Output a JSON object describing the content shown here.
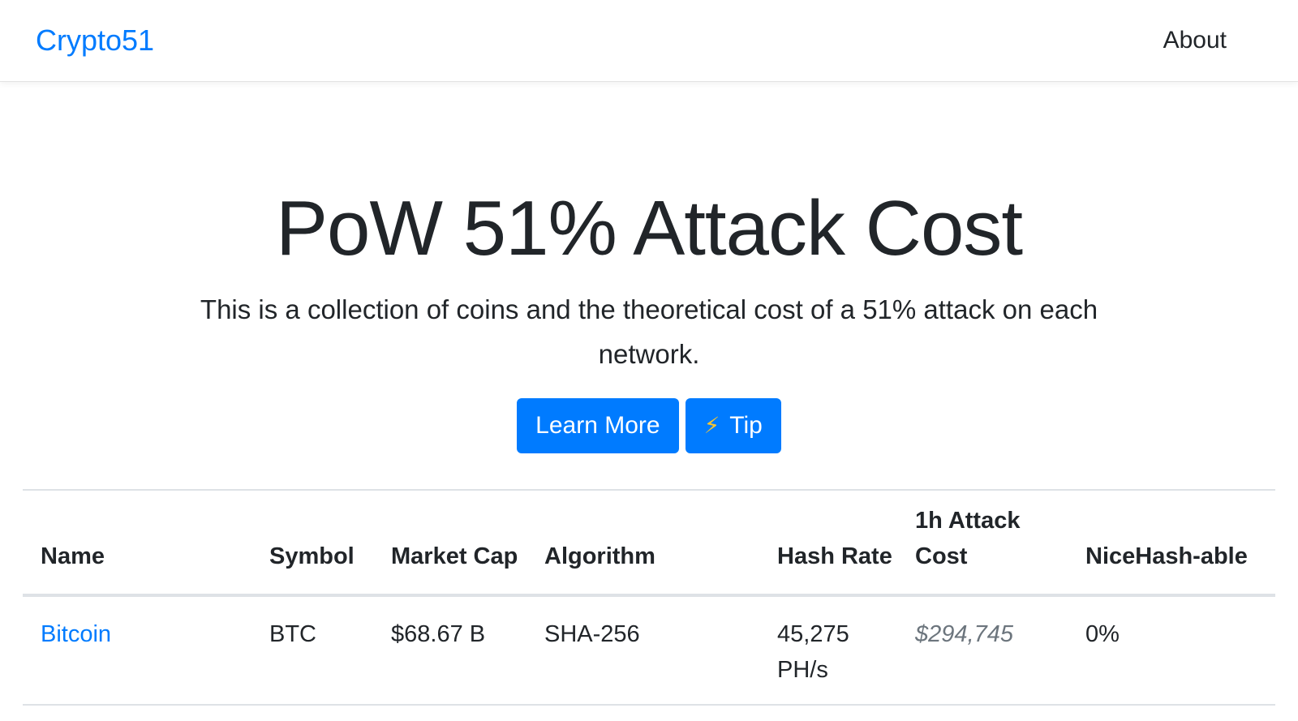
{
  "navbar": {
    "brand": "Crypto51",
    "about_label": "About"
  },
  "hero": {
    "title": "PoW 51% Attack Cost",
    "lead": "This is a collection of coins and the theoretical cost of a 51% attack on each network.",
    "learn_more_label": "Learn More",
    "tip_icon": "lightning-bolt-icon",
    "tip_glyph": "⚡",
    "tip_label": "Tip"
  },
  "table": {
    "headers": [
      "Name",
      "Symbol",
      "Market Cap",
      "Algorithm",
      "Hash Rate",
      "1h Attack Cost",
      "NiceHash-able"
    ],
    "rows": [
      {
        "name": "Bitcoin",
        "symbol": "BTC",
        "market_cap": "$68.67 B",
        "algorithm": "SHA-256",
        "hash_rate": "45,275 PH/s",
        "attack_cost": "$294,745",
        "nicehashable": "0%"
      }
    ]
  },
  "colors": {
    "accent": "#007bff",
    "muted": "#6c757d",
    "border": "#dee2e6",
    "text": "#212529"
  }
}
